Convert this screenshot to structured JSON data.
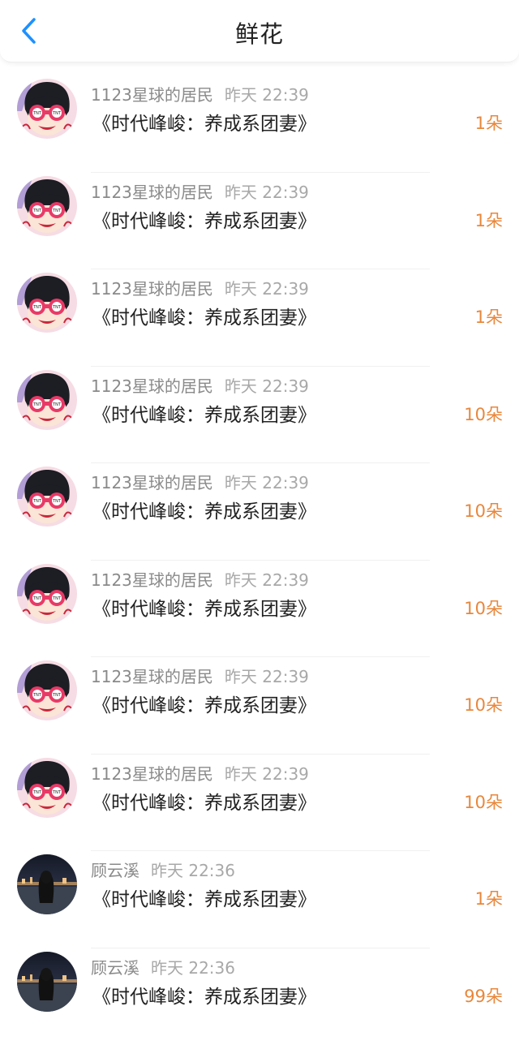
{
  "header": {
    "title": "鲜花",
    "back_icon": "chevron-left-icon",
    "accent": "#1e90ff"
  },
  "colors": {
    "amount": "#e8873c",
    "name": "#8a8a8a"
  },
  "items": [
    {
      "avatar": "cartoon-girl-avatar",
      "user": "1123星球的居民",
      "time": "昨天 22:39",
      "book": "《时代峰峻：养成系团妻》",
      "amount": "1朵"
    },
    {
      "avatar": "cartoon-girl-avatar",
      "user": "1123星球的居民",
      "time": "昨天 22:39",
      "book": "《时代峰峻：养成系团妻》",
      "amount": "1朵"
    },
    {
      "avatar": "cartoon-girl-avatar",
      "user": "1123星球的居民",
      "time": "昨天 22:39",
      "book": "《时代峰峻：养成系团妻》",
      "amount": "1朵"
    },
    {
      "avatar": "cartoon-girl-avatar",
      "user": "1123星球的居民",
      "time": "昨天 22:39",
      "book": "《时代峰峻：养成系团妻》",
      "amount": "10朵"
    },
    {
      "avatar": "cartoon-girl-avatar",
      "user": "1123星球的居民",
      "time": "昨天 22:39",
      "book": "《时代峰峻：养成系团妻》",
      "amount": "10朵"
    },
    {
      "avatar": "cartoon-girl-avatar",
      "user": "1123星球的居民",
      "time": "昨天 22:39",
      "book": "《时代峰峻：养成系团妻》",
      "amount": "10朵"
    },
    {
      "avatar": "cartoon-girl-avatar",
      "user": "1123星球的居民",
      "time": "昨天 22:39",
      "book": "《时代峰峻：养成系团妻》",
      "amount": "10朵"
    },
    {
      "avatar": "cartoon-girl-avatar",
      "user": "1123星球的居民",
      "time": "昨天 22:39",
      "book": "《时代峰峻：养成系团妻》",
      "amount": "10朵"
    },
    {
      "avatar": "night-photo-avatar",
      "user": "顾云溪",
      "time": "昨天 22:36",
      "book": "《时代峰峻：养成系团妻》",
      "amount": "1朵"
    },
    {
      "avatar": "night-photo-avatar",
      "user": "顾云溪",
      "time": "昨天 22:36",
      "book": "《时代峰峻：养成系团妻》",
      "amount": "99朵"
    }
  ]
}
